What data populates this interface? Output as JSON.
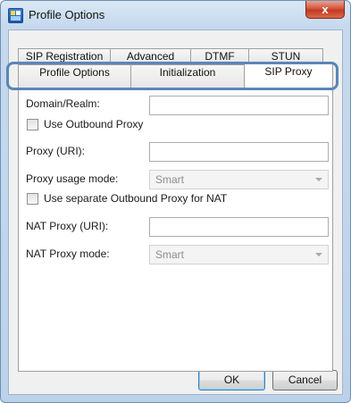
{
  "window": {
    "title": "Profile Options",
    "close_glyph": "x"
  },
  "tabs": {
    "row1": [
      "SIP Registration",
      "Advanced",
      "DTMF",
      "STUN"
    ],
    "row2": [
      "Profile Options",
      "Initialization",
      "SIP Proxy"
    ],
    "active": "SIP Proxy"
  },
  "form": {
    "domain_label": "Domain/Realm:",
    "domain_value": "",
    "use_outbound_label": "Use Outbound Proxy",
    "use_outbound_checked": false,
    "proxy_uri_label": "Proxy (URI):",
    "proxy_uri_value": "",
    "proxy_usage_label": "Proxy usage mode:",
    "proxy_usage_value": "Smart",
    "separate_nat_label": "Use separate Outbound Proxy for NAT",
    "separate_nat_checked": false,
    "nat_proxy_label": "NAT Proxy (URI):",
    "nat_proxy_value": "",
    "nat_mode_label": "NAT Proxy mode:",
    "nat_mode_value": "Smart"
  },
  "buttons": {
    "ok": "OK",
    "cancel": "Cancel"
  }
}
